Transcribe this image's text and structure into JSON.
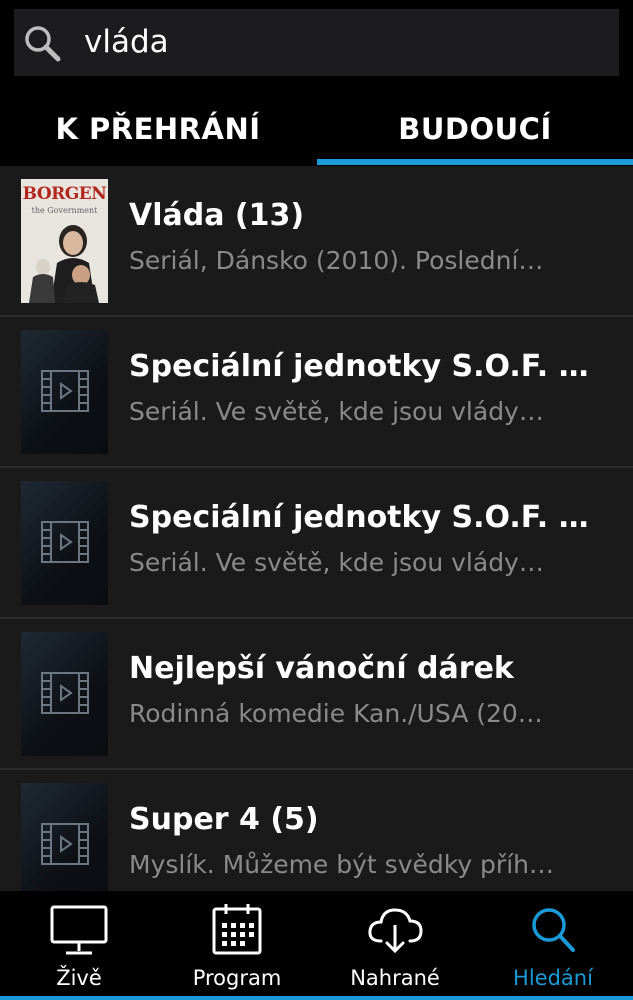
{
  "search": {
    "query": "vláda"
  },
  "tabs": [
    {
      "label": "K PŘEHRÁNÍ",
      "active": false
    },
    {
      "label": "BUDOUCÍ",
      "active": true
    }
  ],
  "results": [
    {
      "title": "Vláda (13)",
      "subtitle": "Seriál, Dánsko (2010). Poslední…",
      "thumbnail": "poster"
    },
    {
      "title": "Speciální jednotky S.O.F. (…",
      "subtitle": "Seriál. Ve světě, kde jsou vlády…",
      "thumbnail": "film-placeholder-icon"
    },
    {
      "title": "Speciální jednotky S.O.F. II…",
      "subtitle": "Seriál. Ve světě, kde jsou vlády…",
      "thumbnail": "film-placeholder-icon"
    },
    {
      "title": "Nejlepší vánoční dárek",
      "subtitle": "Rodinná komedie Kan./USA (20…",
      "thumbnail": "film-placeholder-icon"
    },
    {
      "title": "Super 4 (5)",
      "subtitle": "Myslík. Můžeme být svědky příh…",
      "thumbnail": "film-placeholder-icon"
    }
  ],
  "poster": {
    "title": "BORGEN",
    "subtitle": "the Government"
  },
  "nav": [
    {
      "label": "Živě",
      "icon": "tv-icon",
      "active": false
    },
    {
      "label": "Program",
      "icon": "calendar-icon",
      "active": false
    },
    {
      "label": "Nahrané",
      "icon": "cloud-download-icon",
      "active": false
    },
    {
      "label": "Hledání",
      "icon": "search-icon",
      "active": true
    }
  ],
  "colors": {
    "accent": "#1a9ad6",
    "background": "#1a1a1a",
    "subtitle": "#8a8a8a"
  }
}
